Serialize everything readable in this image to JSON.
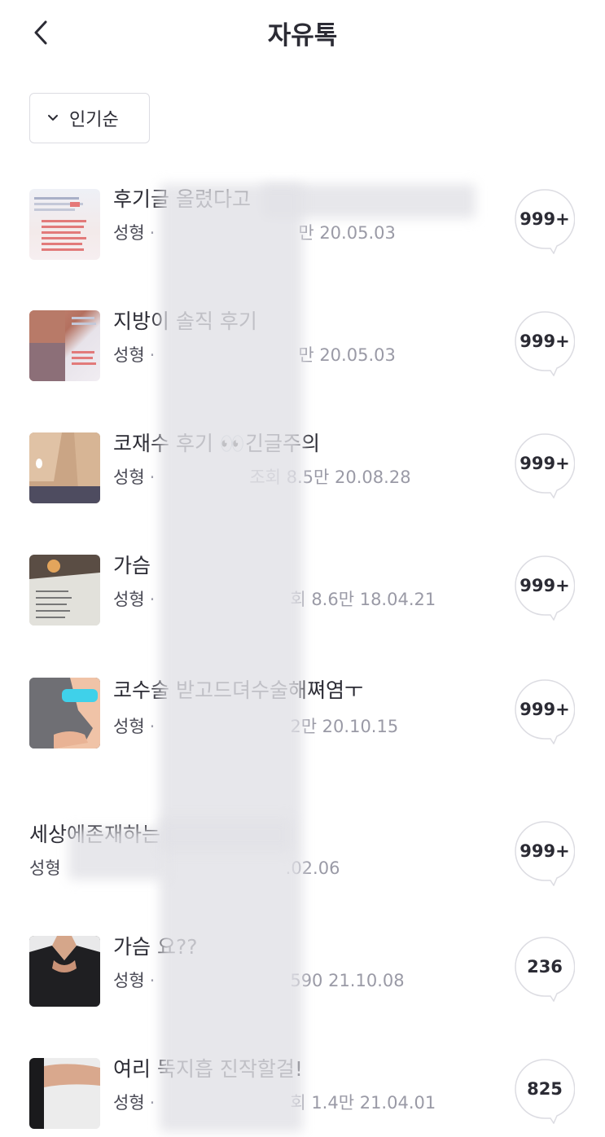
{
  "header": {
    "title": "자유톡",
    "back_icon": "chevron-left-icon"
  },
  "sort": {
    "label": "인기순",
    "icon": "chevron-down-icon"
  },
  "colors": {
    "text": "#2b2b34",
    "muted": "#9a9aa6",
    "border": "#dcdce2"
  },
  "posts": [
    {
      "title": "후기글 올렸다고",
      "category": "성형",
      "stats": "만  20.05.03",
      "comments": "999+"
    },
    {
      "title": "지방이 솔직 후기",
      "category": "성형",
      "stats": "만  20.05.03",
      "comments": "999+"
    },
    {
      "title": "코재수 후기 👀긴글주의",
      "category": "성형",
      "stats": "조회 8.5만  20.08.28",
      "comments": "999+"
    },
    {
      "title": "가슴",
      "category": "성형",
      "stats": "회 8.6만  18.04.21",
      "comments": "999+"
    },
    {
      "title": "코수술 받고드뎌수술해쪄염ㅜ",
      "category": "성형",
      "stats": "2만  20.10.15",
      "comments": "999+"
    },
    {
      "title": "세상에존재하는",
      "category": "성형",
      "stats": ".02.06",
      "comments": "999+"
    },
    {
      "title": "가슴 요??",
      "category": "성형",
      "stats": "590  21.10.08",
      "comments": "236"
    },
    {
      "title": "여리 뚝지흡 진작할걸!",
      "category": "성형",
      "stats": "회 1.4만  21.04.01",
      "comments": "825"
    }
  ]
}
